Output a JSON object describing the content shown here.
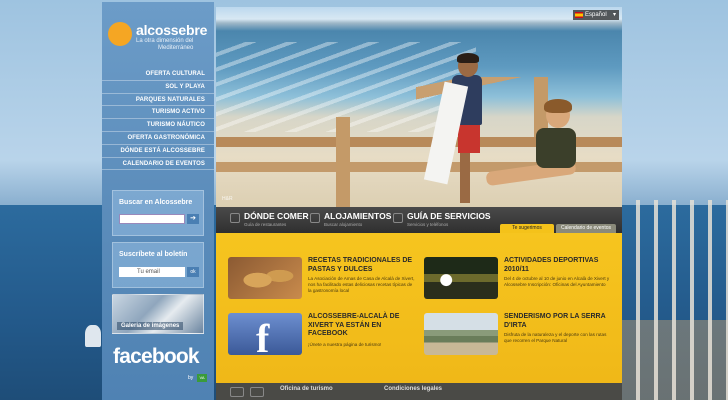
{
  "sidebar": {
    "logo_name": "alcossebre",
    "logo_tag1": "La otra dimensión del",
    "logo_tag2": "Mediterráneo",
    "menu": [
      "OFERTA CULTURAL",
      "SOL Y PLAYA",
      "PARQUES NATURALES",
      "TURISMO ACTIVO",
      "TURISMO NÁUTICO",
      "OFERTA GASTRONÓMICA",
      "DÓNDE ESTÁ ALCOSSEBRE",
      "CALENDARIO DE EVENTOS"
    ],
    "search": {
      "title": "Buscar en Alcossebre",
      "value": "",
      "button": "➔"
    },
    "newsletter": {
      "title": "Suscríbete al boletín",
      "placeholder": "Tu email",
      "button": "ok"
    },
    "gallery_label": "Galeria de imágenes",
    "facebook": "facebook",
    "by": "by",
    "by_logo": "VA"
  },
  "hero": {
    "language": "Español",
    "caption": "H&R"
  },
  "tabs": [
    {
      "title": "DÓNDE COMER",
      "sub": "Guía de restaurantes"
    },
    {
      "title": "ALOJAMIENTOS",
      "sub": "Buscar alojamiento"
    },
    {
      "title": "GUÍA DE SERVICIOS",
      "sub": "Servicios y teléfonos"
    }
  ],
  "subtabs": {
    "active": "Te sugerimos",
    "other": "Calendario de eventos"
  },
  "cards": [
    {
      "title": "RECETAS TRADICIONALES DE PASTAS Y DULCES",
      "text": "La Asociación de Amas de Casa de Alcalà de Xivert, nos ha facilitado estas deliciosas recetas típicas de la gastronomía local"
    },
    {
      "title": "ACTIVIDADES DEPORTIVAS 2010/11",
      "text": "Del 4 de octubre al 10 de junio en Alcalà de Xivert y Alcossebre Inscripción: Oficinas del Ayuntamiento"
    },
    {
      "title": "ALCOSSEBRE-ALCALÀ DE XIVERT YA ESTÁN EN FACEBOOK",
      "text": "¡Únete a nuestra página de turismo!"
    },
    {
      "title": "SENDERISMO POR LA SERRA D'IRTA",
      "text": "Disfruta de la naturaleza y el deporte con las rutas que recorren el Parque Natural"
    }
  ],
  "footer": {
    "link1": "Oficina de turismo",
    "link2": "Condiciones legales"
  },
  "colors": {
    "accent": "#f4c21a",
    "sidebar": "#5c8dbb",
    "tabbar": "#333333"
  }
}
